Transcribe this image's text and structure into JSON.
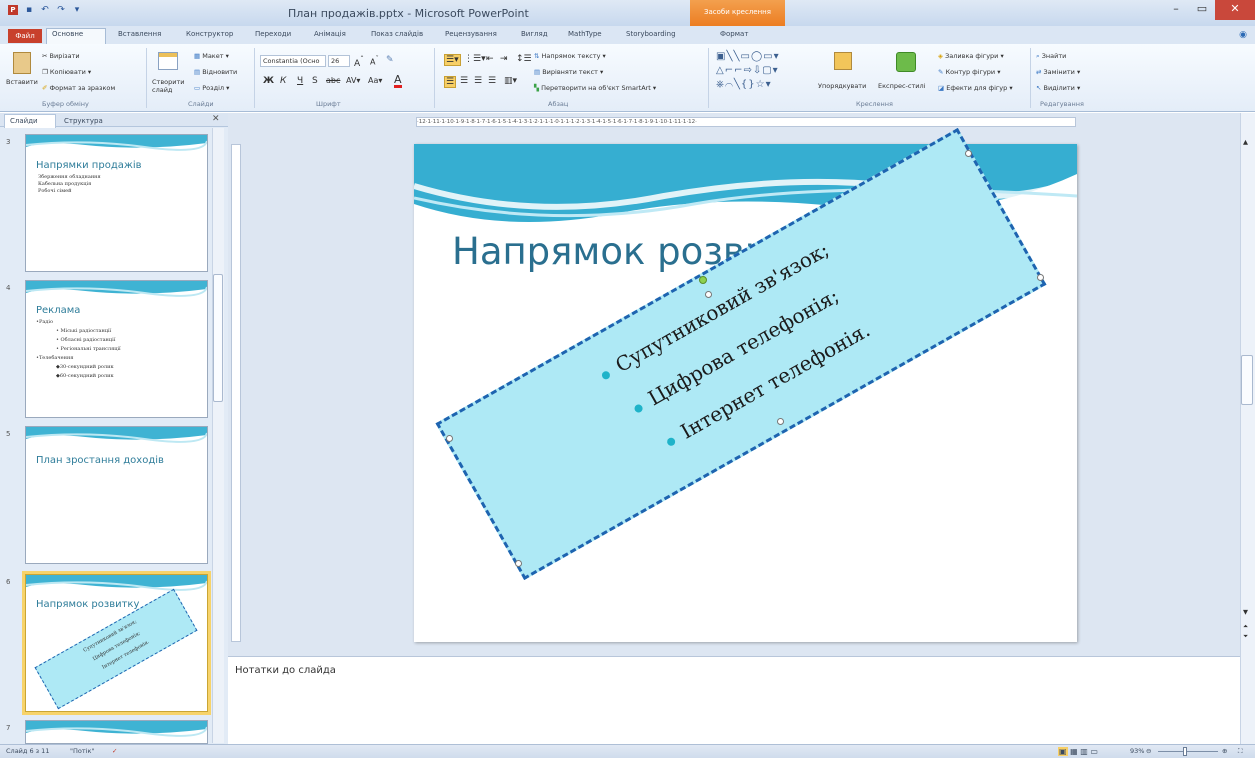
{
  "window": {
    "title": "План продажів.pptx - Microsoft PowerPoint",
    "context_tab_title": "Засоби креслення"
  },
  "ribbon_tabs": [
    "Файл",
    "Основне",
    "Вставлення",
    "Конструктор",
    "Переходи",
    "Анімація",
    "Показ слайдів",
    "Рецензування",
    "Вигляд",
    "MathType",
    "Storyboarding",
    "Формат"
  ],
  "clipboard": {
    "paste": "Вставити",
    "cut": "Вирізати",
    "copy": "Копіювати",
    "format_painter": "Формат за зразком",
    "group": "Буфер обміну"
  },
  "slides_group": {
    "new_slide": "Створити слайд",
    "layout": "Макет",
    "reset": "Відновити",
    "section": "Розділ",
    "group": "Слайди"
  },
  "font_group": {
    "font_name": "Constantia (Осно",
    "font_size": "26",
    "group": "Шрифт"
  },
  "paragraph_group": {
    "text_direction": "Напрямок тексту",
    "align_text": "Вирівняти текст",
    "smartart": "Перетворити на об'єкт SmartArt",
    "group": "Абзац"
  },
  "drawing_group": {
    "arrange": "Упорядкувати",
    "quick_styles": "Експрес-стилі",
    "shape_fill": "Заливка фігури",
    "shape_outline": "Контур фігури",
    "shape_effects": "Ефекти для фігур",
    "group": "Креслення"
  },
  "editing_group": {
    "find": "Знайти",
    "replace": "Замінити",
    "select": "Виділити",
    "group": "Редагування"
  },
  "panel_tabs": [
    "Слайди",
    "Структура"
  ],
  "thumbnails": [
    {
      "num": "3",
      "title": "Напрямки продажів",
      "lines": [
        "Зберження обладнання",
        "Кабельна продукція",
        "Робочі сімей"
      ]
    },
    {
      "num": "4",
      "title": "Реклама",
      "lines": [
        "•Радіо",
        "• Міські радіостанції",
        "• Обласні радіостанції",
        "• Регіональні трансляції",
        "•Телебачення",
        "◆30-секундний ролик",
        "◆60-секундний ролик"
      ]
    },
    {
      "num": "5",
      "title": "План зростання доходів"
    },
    {
      "num": "6",
      "title": "Напрямок розвитку",
      "lines": [
        "Супутниковий зв'язок;",
        "Цифрова телефонія;",
        "Інтернет телефонія."
      ]
    },
    {
      "num": "7"
    }
  ],
  "ruler_text": "·12·1·11·1·10·1·9·1·8·1·7·1·6·1·5·1·4·1·3·1·2·1·1·1·0·1·1·1·2·1·3·1·4·1·5·1·6·1·7·1·8·1·9·1·10·1·11·1·12·",
  "slide": {
    "title": "Напрямок розвитку",
    "bullets": [
      "Супутниковий зв'язок;",
      "Цифрова телефонія;",
      "Інтернет телефонія."
    ]
  },
  "notes_placeholder": "Нотатки до слайда",
  "status": {
    "slide_info": "Слайд 6 з 11",
    "theme": "\"Потік\"",
    "zoom": "93%"
  },
  "colors": {
    "accent_file": "#c8402c",
    "shape_fill": "#aee9f5",
    "shape_border": "#1e64b0",
    "title_color": "#2a6f8f",
    "bullet_color": "#1fb3c9",
    "context_tab": "#ec7d22"
  }
}
